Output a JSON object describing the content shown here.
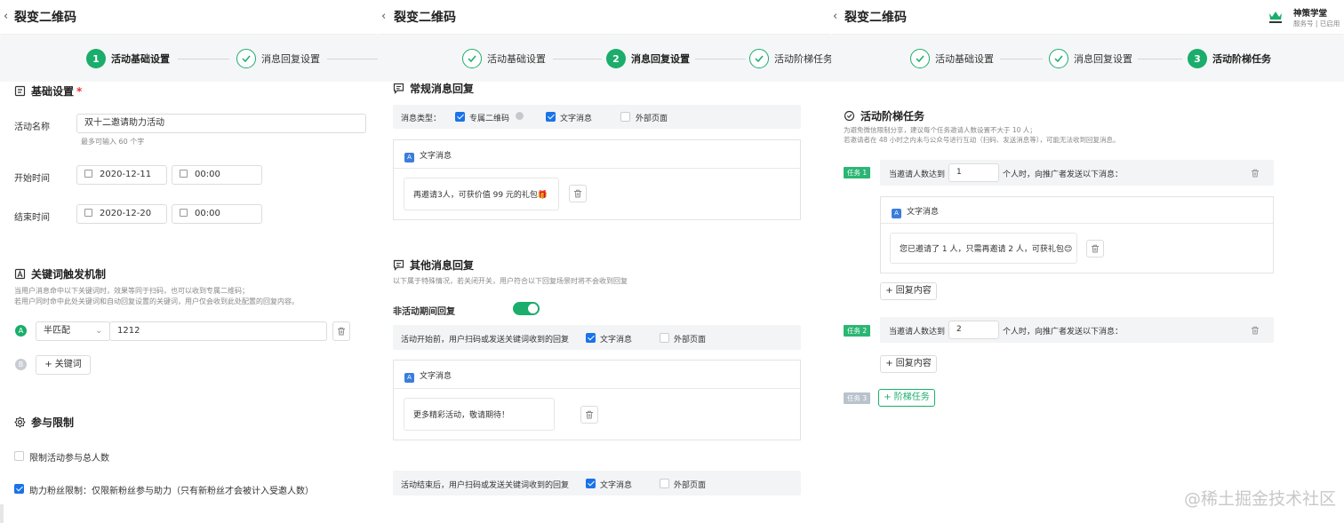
{
  "colors": {
    "accent": "#1aad6b",
    "checkbox": "#1a73e8",
    "header_bg": "#ffffff",
    "steps_bg": "#f5f6f7"
  },
  "panel1": {
    "header": {
      "back": "‹",
      "title": "裂变二维码"
    },
    "steps": [
      {
        "num": "1",
        "label": "活动基础设置",
        "state": "active"
      },
      {
        "label": "消息回复设置",
        "state": "done"
      }
    ],
    "basic": {
      "title": "基础设置",
      "required": "*",
      "name_label": "活动名称",
      "name_value": "双十二邀请助力活动",
      "name_hint": "最多可输入 60 个字",
      "start_label": "开始时间",
      "start_date": "2020-12-11",
      "start_time": "00:00",
      "end_label": "结束时间",
      "end_date": "2020-12-20",
      "end_time": "00:00"
    },
    "keyword": {
      "title": "关键词触发机制",
      "hint1": "当用户消息命中以下关键词时，效果等同于扫码，也可以收到专属二维码；",
      "hint2": "若用户同时命中此处关键词和自动回复设置的关键词，用户仅会收到此处配置的回复内容。",
      "row_letter": "A",
      "match": "半匹配",
      "match_arrow": "⌄",
      "value": "1212",
      "add_letter": "B",
      "add_label": "+ 关键词"
    },
    "limit": {
      "title": "参与限制",
      "opt1": "限制活动参与总人数",
      "opt2": "助力粉丝限制：仅限新粉丝参与助力（只有新粉丝才会被计入受邀人数）"
    }
  },
  "panel2": {
    "header": {
      "back": "‹",
      "title": "裂变二维码"
    },
    "steps": [
      {
        "label": "活动基础设置",
        "state": "done"
      },
      {
        "num": "2",
        "label": "消息回复设置",
        "state": "active"
      },
      {
        "label": "活动阶梯任务",
        "state": "done"
      }
    ],
    "regular": {
      "title": "常规消息回复",
      "type_label": "消息类型：",
      "opt1": "专属二维码",
      "opt2": "文字消息",
      "opt3": "外部页面",
      "card_title": "文字消息",
      "message": "再邀请3人，可获价值 99 元的礼包🎁"
    },
    "other": {
      "title": "其他消息回复",
      "hint": "以下属于特殊情况，若关闭开关，用户符合以下回复场景时将不会收到回复",
      "inactive_label": "非活动期间回复",
      "before_label": "活动开始前，用户扫码或发送关键词收到的回复",
      "opt_text": "文字消息",
      "opt_page": "外部页面",
      "card_title": "文字消息",
      "message": "更多精彩活动，敬请期待！",
      "after_label": "活动结束后，用户扫码或发送关键词收到的回复",
      "opt_text2": "文字消息",
      "opt_page2": "外部页面"
    }
  },
  "panel3": {
    "header": {
      "back": "‹",
      "title": "裂变二维码"
    },
    "account": {
      "name": "神策学堂",
      "sub": "服务号 | 已启用"
    },
    "steps": [
      {
        "label": "活动基础设置",
        "state": "done"
      },
      {
        "label": "消息回复设置",
        "state": "done"
      },
      {
        "num": "3",
        "label": "活动阶梯任务",
        "state": "active"
      }
    ],
    "ladder": {
      "title": "活动阶梯任务",
      "hint1": "为避免微信限制分享，建议每个任务邀请人数设置不大于 10 人；",
      "hint2": "若邀请者在 48 小时之内未与公众号进行互动（扫码、发送消息等），可能无法收到回复消息。",
      "task1_tag": "任务 1",
      "task_prefix": "当邀请人数达到",
      "task1_value": "1",
      "task_suffix": "个人时，向推广者发送以下消息：",
      "card_title": "文字消息",
      "task1_message": "您已邀请了 1 人，只需再邀请 2 人，可获礼包😊",
      "add_reply": "+ 回复内容",
      "task2_tag": "任务 2",
      "task2_value": "2",
      "add_reply2": "+ 回复内容",
      "task3_tag": "任务 3",
      "add_task": "+ 阶梯任务"
    }
  },
  "watermark": "@稀土掘金技术社区"
}
